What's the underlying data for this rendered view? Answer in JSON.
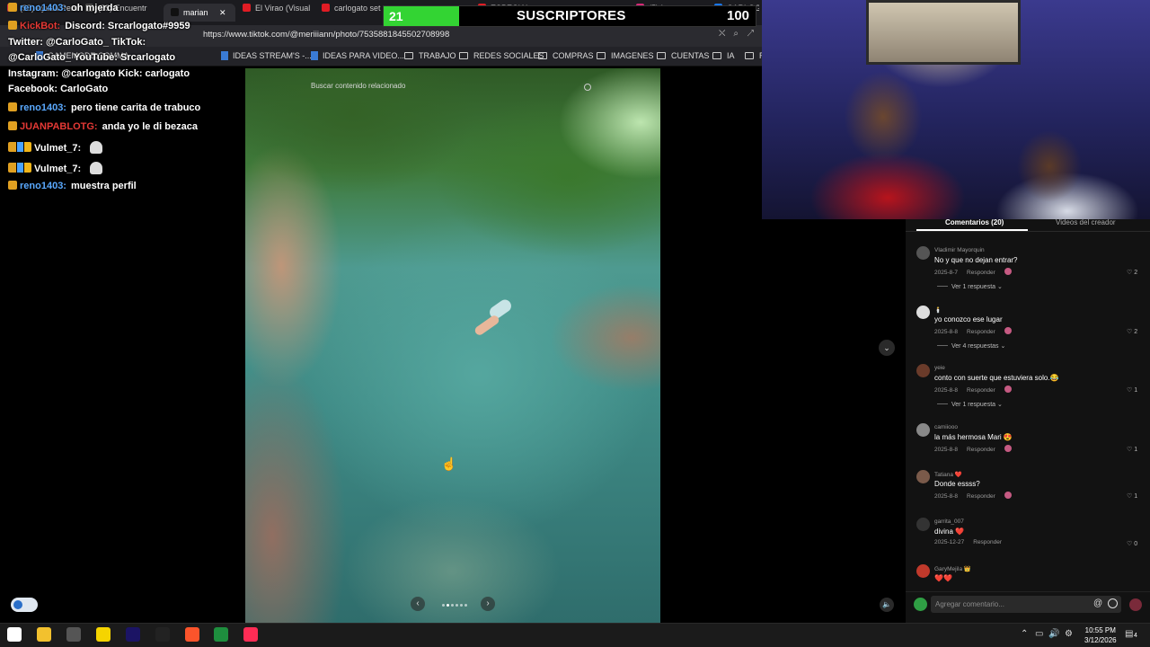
{
  "browser": {
    "tabs": [
      {
        "label": "(55) Ayuda Perso",
        "fav": "#c9303e"
      },
      {
        "label": "(55) Encuentr",
        "fav": "#555"
      },
      {
        "label": "marian",
        "fav": "#111",
        "active": true
      },
      {
        "label": "El Virao (Visual",
        "fav": "#e01c24"
      },
      {
        "label": "carlogato set",
        "fav": "#e01c24"
      },
      {
        "label": "ESPECIAL",
        "fav": "#e01c24"
      },
      {
        "label": "(5) Instagram",
        "fav": "#d62976"
      },
      {
        "label": "CARLOGATO",
        "fav": "#1877f2"
      }
    ],
    "url": "https://www.tiktok.com/@meriiiann/photo/7535881845502708998",
    "bookmarks": [
      {
        "label": "GAMEMODE.COMMA",
        "type": "doc"
      },
      {
        "label": "IDEAS STREAM'S -...",
        "type": "doc"
      },
      {
        "label": "IDEAS PARA VIDEO...",
        "type": "doc"
      },
      {
        "label": "TRABAJO",
        "type": "folder"
      },
      {
        "label": "REDES SOCIALES",
        "type": "folder"
      },
      {
        "label": "COMPRAS",
        "type": "folder"
      },
      {
        "label": "IMAGENES",
        "type": "folder"
      },
      {
        "label": "CUENTAS",
        "type": "folder"
      },
      {
        "label": "IA",
        "type": "folder"
      },
      {
        "label": "R",
        "type": "folder"
      }
    ]
  },
  "subscribers": {
    "current": "21",
    "label": "SUSCRIPTORES",
    "goal": "100",
    "progress": 0.21,
    "color": "#33d433"
  },
  "chat": [
    {
      "user": "reno1403:",
      "user_color": "#5aa9ff",
      "text": "oh mjerda",
      "badge": true
    },
    {
      "user": "KickBot:",
      "user_color": "#e53935",
      "text": "Discord: Srcarlogato#9959",
      "badge": true
    },
    {
      "user": "",
      "user_color": "#fff",
      "text": "Twitter: @CarloGato_ TikTok:",
      "badge": false
    },
    {
      "user": "",
      "user_color": "#fff",
      "text": "@CarloGato_ YouTube: Srcarlogato",
      "badge": false
    },
    {
      "user": "",
      "user_color": "#fff",
      "text": "Instagram: @carlogato Kick: carlogato",
      "badge": false
    },
    {
      "user": "",
      "user_color": "#fff",
      "text": "Facebook: CarloGato",
      "badge": false
    },
    {
      "user": "reno1403:",
      "user_color": "#5aa9ff",
      "text": "pero tiene carita de trabuco",
      "badge": true
    },
    {
      "user": "JUANPABLOTG:",
      "user_color": "#e53935",
      "text": "anda yo le di bezaca",
      "badge": true
    },
    {
      "user": "Vulmet_7:",
      "user_color": "#ffffff",
      "text": "",
      "badge": true,
      "icons": true,
      "ghost": true
    },
    {
      "user": "Vulmet_7:",
      "user_color": "#ffffff",
      "text": "",
      "badge": true,
      "icons": true,
      "ghost": true
    },
    {
      "user": "reno1403:",
      "user_color": "#5aa9ff",
      "text": "muestra perfil",
      "badge": true
    }
  ],
  "photo": {
    "search_placeholder": "Buscar contenido relacionado"
  },
  "comments_panel": {
    "tab_comments": "Comentarios (20)",
    "tab_creator": "Videos del creador",
    "reply_label": "Responder",
    "comments": [
      {
        "user": "Vladimir Mayorquin",
        "text": "No y que no dejan entrar?",
        "date": "2025-8-7",
        "likes": "2",
        "replies": "Ver 1 respuesta",
        "creator_liked": true,
        "avatar": "#555"
      },
      {
        "user": "🕯️",
        "text": "yo conozco ese lugar",
        "date": "2025-8-8",
        "likes": "2",
        "replies": "Ver 4 respuestas",
        "creator_liked": true,
        "avatar": "#ddd"
      },
      {
        "user": "yeie",
        "text": "conto con suerte que estuviera solo.😂",
        "date": "2025-8-8",
        "likes": "1",
        "replies": "Ver 1 respuesta",
        "creator_liked": true,
        "avatar": "#6a3b2a"
      },
      {
        "user": "camiiooo",
        "text": "la más hermosa Mari 😍",
        "date": "2025-8-8",
        "likes": "1",
        "replies": "",
        "creator_liked": true,
        "avatar": "#888"
      },
      {
        "user": "Tatiana ❤️",
        "text": "Donde essss?",
        "date": "2025-8-8",
        "likes": "1",
        "replies": "",
        "creator_liked": true,
        "avatar": "#7a5a4a"
      },
      {
        "user": "garrita_007",
        "text": "divina ❤️",
        "date": "2025-12-27",
        "likes": "0",
        "replies": "",
        "creator_liked": false,
        "avatar": "#333"
      },
      {
        "user": "GaryMejila 👑",
        "text": "❤️❤️",
        "date": "",
        "likes": "",
        "replies": "",
        "creator_liked": false,
        "avatar": "#c0392b"
      }
    ],
    "input_placeholder": "Agregar comentario..."
  },
  "taskbar": {
    "time": "10:55 PM",
    "date": "3/12/2026",
    "notifications": "4",
    "apps": [
      {
        "name": "windows-start-icon",
        "color": "#ffffff"
      },
      {
        "name": "file-explorer-icon",
        "color": "#f2c12e"
      },
      {
        "name": "obs-icon",
        "color": "#555555"
      },
      {
        "name": "sticky-notes-icon",
        "color": "#f5d400"
      },
      {
        "name": "premiere-icon",
        "color": "#1b1464"
      },
      {
        "name": "capcut-icon",
        "color": "#222222"
      },
      {
        "name": "brave-icon",
        "color": "#fb542b"
      },
      {
        "name": "sheets-icon",
        "color": "#1e8e3e"
      },
      {
        "name": "tiktok-icon",
        "color": "#fe2c55"
      }
    ]
  }
}
